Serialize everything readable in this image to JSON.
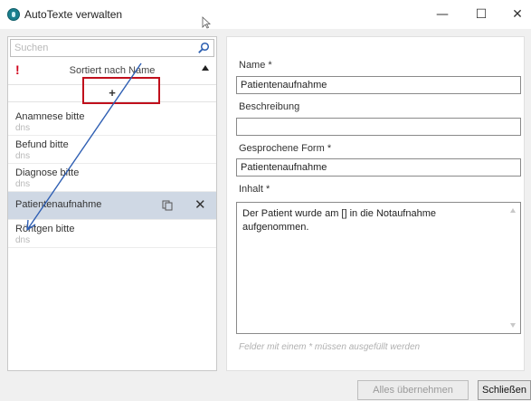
{
  "window": {
    "title": "AutoTexte verwalten",
    "minimize_glyph": "—",
    "maximize_glyph": "☐",
    "close_glyph": "✕"
  },
  "sidebar": {
    "search_placeholder": "Suchen",
    "sort_label": "Sortiert nach Name",
    "important_glyph": "!",
    "add_glyph": "+",
    "items": [
      {
        "label": "Anamnese bitte",
        "sub": "dns"
      },
      {
        "label": "Befund bitte",
        "sub": "dns"
      },
      {
        "label": "Diagnose bitte",
        "sub": "dns"
      },
      {
        "label": "Patientenaufnahme",
        "sub": ""
      },
      {
        "label": "Röntgen bitte",
        "sub": "dns"
      }
    ],
    "selected_index": 3,
    "delete_glyph": "✕"
  },
  "form": {
    "name_label": "Name *",
    "name_value": "Patientenaufnahme",
    "description_label": "Beschreibung",
    "description_value": "",
    "spoken_label": "Gesprochene Form *",
    "spoken_value": "Patientenaufnahme",
    "content_label": "Inhalt *",
    "content_value": "Der Patient wurde am [] in die Notaufnahme aufgenommen.",
    "required_hint": "Felder mit einem * müssen ausgefüllt werden"
  },
  "footer": {
    "apply_label": "Alles übernehmen",
    "close_label": "Schließen"
  },
  "colors": {
    "selection": "#cfd8e4",
    "highlight_box": "#c0101c",
    "annotation_arrow": "#2f5fb3",
    "important": "#d0021b"
  }
}
